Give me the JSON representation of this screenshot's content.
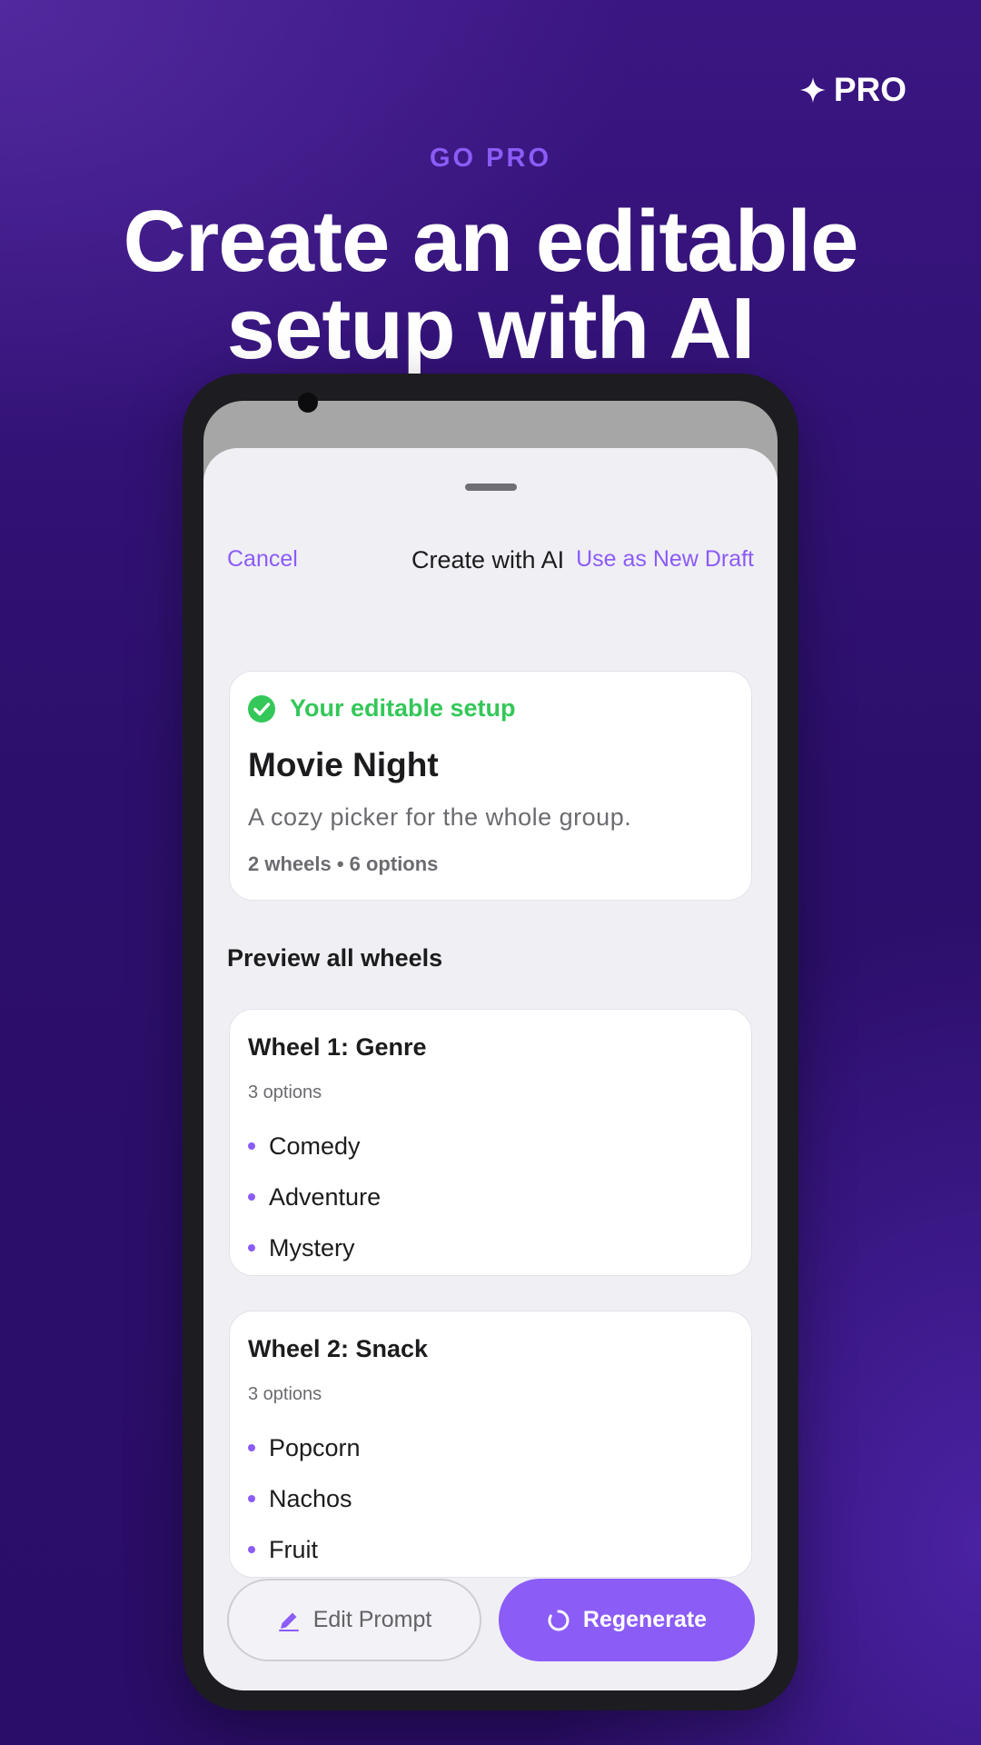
{
  "promo": {
    "pro_badge": "PRO",
    "eyebrow": "GO PRO",
    "headline_line1": "Create an editable",
    "headline_line2": "setup with AI"
  },
  "sheet": {
    "nav": {
      "cancel": "Cancel",
      "title": "Create with AI",
      "use_draft": "Use as New Draft"
    },
    "summary": {
      "status": "Your editable setup",
      "title": "Movie Night",
      "description": "A cozy picker for the whole group.",
      "meta": "2 wheels • 6 options"
    },
    "section_title": "Preview all wheels",
    "wheels": [
      {
        "title": "Wheel 1: Genre",
        "count": "3 options",
        "options": [
          "Comedy",
          "Adventure",
          "Mystery"
        ]
      },
      {
        "title": "Wheel 2: Snack",
        "count": "3 options",
        "options": [
          "Popcorn",
          "Nachos",
          "Fruit"
        ]
      }
    ],
    "actions": {
      "edit": "Edit Prompt",
      "regenerate": "Regenerate"
    }
  },
  "icons": {
    "pro": "sparkle-icon",
    "status": "check-circle-icon",
    "edit": "pencil-icon",
    "regenerate": "refresh-icon"
  },
  "colors": {
    "accent": "#8b5cf6",
    "success": "#34c759",
    "background": "#2c0f6c"
  }
}
